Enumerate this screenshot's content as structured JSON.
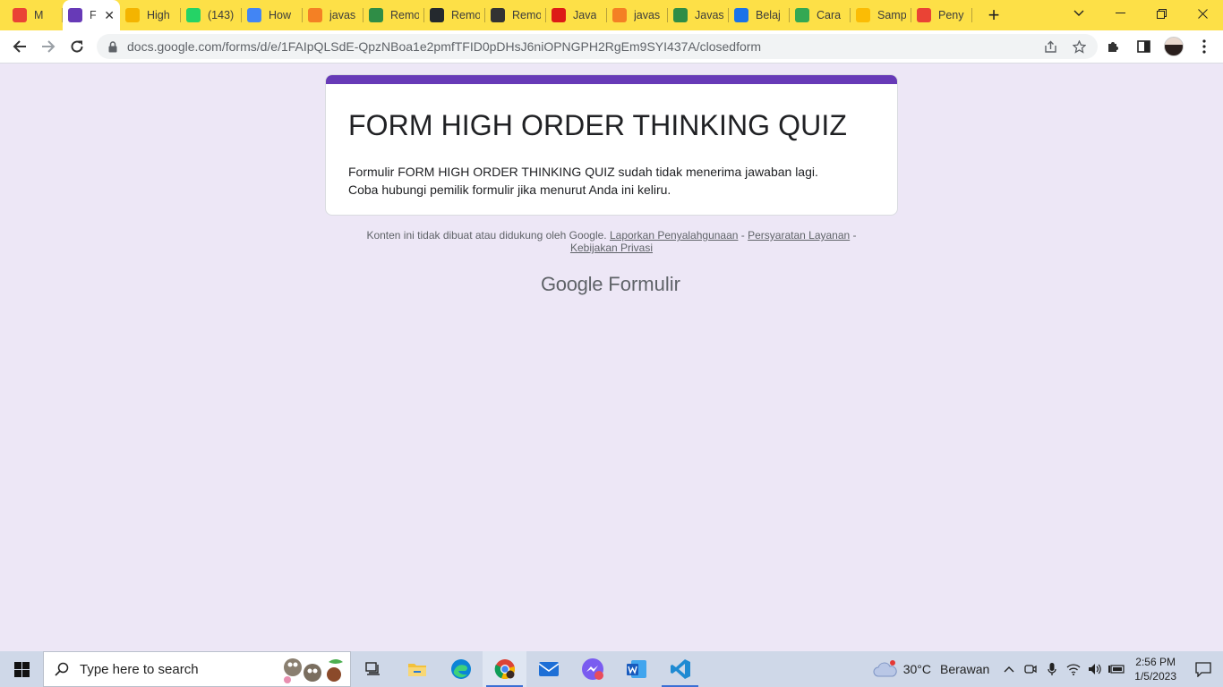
{
  "browser": {
    "tabs": [
      {
        "title": "M",
        "icon": "gmail-icon",
        "color": "#ea4335"
      },
      {
        "title": "Fo",
        "icon": "google-forms-icon",
        "color": "#673ab7",
        "active": true
      },
      {
        "title": "High",
        "icon": "google-slides-icon",
        "color": "#f4b400"
      },
      {
        "title": "(143)",
        "icon": "whatsapp-icon",
        "color": "#25d366"
      },
      {
        "title": "How",
        "icon": "google-icon",
        "color": "#4285f4"
      },
      {
        "title": "javas",
        "icon": "stackoverflow-icon",
        "color": "#f48024"
      },
      {
        "title": "Remo",
        "icon": "geeksforgeeks-icon",
        "color": "#2f8d46"
      },
      {
        "title": "Remo",
        "icon": "github-icon",
        "color": "#24292e"
      },
      {
        "title": "Remo",
        "icon": "chevron-site-icon",
        "color": "#333333"
      },
      {
        "title": "Java",
        "icon": "vue-icon",
        "color": "#dd1b16"
      },
      {
        "title": "javas",
        "icon": "stackoverflow-icon",
        "color": "#f48024"
      },
      {
        "title": "Javas",
        "icon": "geeksforgeeks-icon",
        "color": "#2f8d46"
      },
      {
        "title": "Belaj",
        "icon": "code-site-icon",
        "color": "#1a73e8"
      },
      {
        "title": "Cara",
        "icon": "cube-icon",
        "color": "#34a853"
      },
      {
        "title": "Samp",
        "icon": "google-drive-icon",
        "color": "#fbbc04"
      },
      {
        "title": "Peny",
        "icon": "pin-icon",
        "color": "#ea4335"
      }
    ],
    "url": "docs.google.com/forms/d/e/1FAIpQLSdE-QpzNBoa1e2pmfTFID0pDHsJ6niOPNGPH2RgEm9SYI437A/closedform",
    "close_tab_glyph": "✕",
    "new_tab_glyph": "+"
  },
  "form": {
    "title": "FORM HIGH ORDER THINKING QUIZ",
    "message_line1": "Formulir FORM HIGH ORDER THINKING QUIZ sudah tidak menerima jawaban lagi.",
    "message_line2": "Coba hubungi pemilik formulir jika menurut Anda ini keliru.",
    "accent_color": "#673ab7",
    "background_color": "#ede7f6"
  },
  "footer": {
    "disclaimer": "Konten ini tidak dibuat atau didukung oleh Google.",
    "link_abuse": "Laporkan Penyalahgunaan",
    "separator": " - ",
    "link_terms": "Persyaratan Layanan",
    "link_privacy": "Kebijakan Privasi",
    "brand_google": "Google",
    "brand_product": "Formulir"
  },
  "taskbar": {
    "search_placeholder": "Type here to search",
    "apps": [
      "task-view-icon",
      "file-explorer-icon",
      "edge-icon",
      "chrome-icon",
      "mail-icon",
      "messenger-icon",
      "word-icon",
      "vscode-icon"
    ],
    "weather_temp": "30°C",
    "weather_desc": "Berawan",
    "time": "2:56 PM",
    "date": "1/5/2023"
  }
}
